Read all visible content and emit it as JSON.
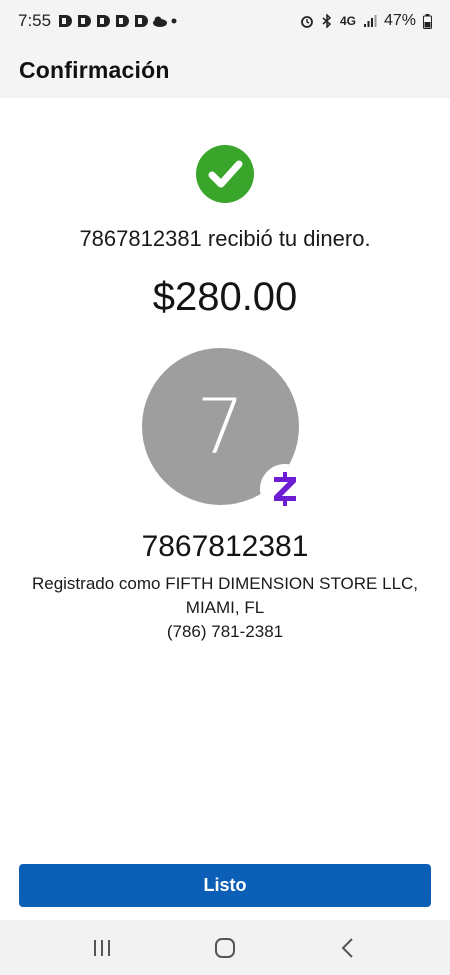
{
  "status_bar": {
    "time": "7:55",
    "battery": "47%",
    "network": "4G"
  },
  "header": {
    "title": "Confirmación"
  },
  "confirmation": {
    "message": "7867812381 recibió tu dinero.",
    "amount": "$280.00"
  },
  "recipient": {
    "avatar_initial": "7",
    "name": "7867812381",
    "registered_line1": "Registrado como FIFTH DIMENSION STORE LLC,",
    "registered_line2": "MIAMI, FL",
    "phone": "(786) 781-2381"
  },
  "actions": {
    "done_label": "Listo"
  },
  "icons": {
    "success": "check-circle-icon",
    "badge": "zelle-icon"
  },
  "colors": {
    "success": "#3aa52b",
    "primary": "#0c5fb6",
    "zelle": "#6d1ed4",
    "avatar_bg": "#9e9e9e"
  }
}
